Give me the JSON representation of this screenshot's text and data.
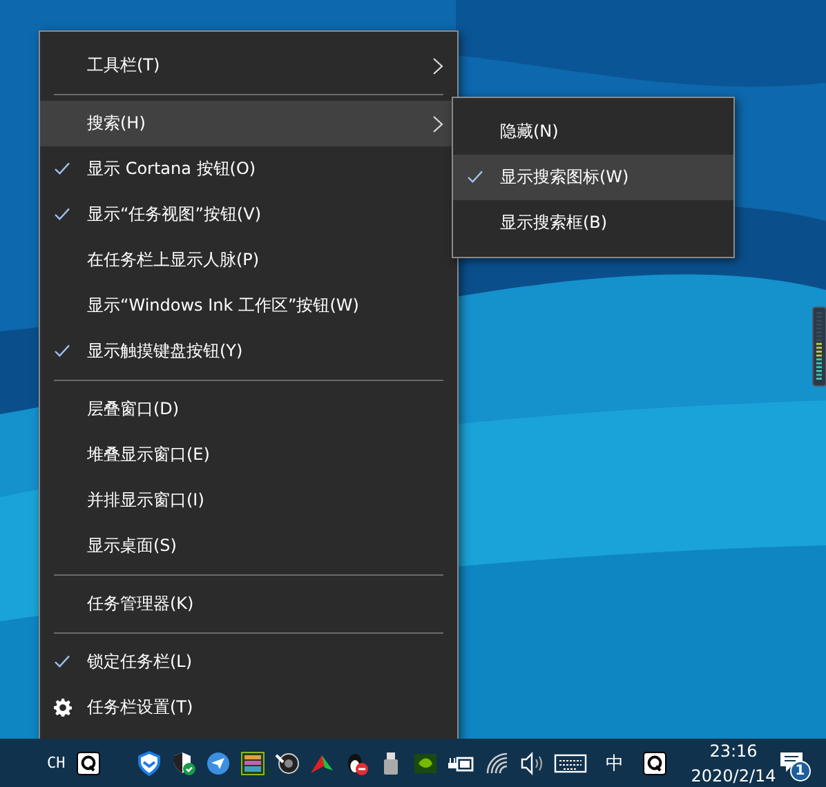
{
  "context_menu": {
    "items": [
      {
        "kind": "item",
        "label": "工具栏(T)",
        "checked": false,
        "selected": false,
        "has_submenu": true
      },
      {
        "kind": "separator"
      },
      {
        "kind": "item",
        "label": "搜索(H)",
        "checked": false,
        "selected": true,
        "has_submenu": true
      },
      {
        "kind": "item",
        "label": "显示 Cortana 按钮(O)",
        "checked": true,
        "selected": false,
        "has_submenu": false
      },
      {
        "kind": "item",
        "label": "显示“任务视图”按钮(V)",
        "checked": true,
        "selected": false,
        "has_submenu": false
      },
      {
        "kind": "item",
        "label": "在任务栏上显示人脉(P)",
        "checked": false,
        "selected": false,
        "has_submenu": false
      },
      {
        "kind": "item",
        "label": "显示“Windows Ink 工作区”按钮(W)",
        "checked": false,
        "selected": false,
        "has_submenu": false
      },
      {
        "kind": "item",
        "label": "显示触摸键盘按钮(Y)",
        "checked": true,
        "selected": false,
        "has_submenu": false
      },
      {
        "kind": "separator"
      },
      {
        "kind": "item",
        "label": "层叠窗口(D)",
        "checked": false,
        "selected": false,
        "has_submenu": false
      },
      {
        "kind": "item",
        "label": "堆叠显示窗口(E)",
        "checked": false,
        "selected": false,
        "has_submenu": false
      },
      {
        "kind": "item",
        "label": "并排显示窗口(I)",
        "checked": false,
        "selected": false,
        "has_submenu": false
      },
      {
        "kind": "item",
        "label": "显示桌面(S)",
        "checked": false,
        "selected": false,
        "has_submenu": false
      },
      {
        "kind": "separator"
      },
      {
        "kind": "item",
        "label": "任务管理器(K)",
        "checked": false,
        "selected": false,
        "has_submenu": false
      },
      {
        "kind": "separator"
      },
      {
        "kind": "item",
        "label": "锁定任务栏(L)",
        "checked": true,
        "selected": false,
        "has_submenu": false
      },
      {
        "kind": "settings",
        "label": "任务栏设置(T)",
        "checked": false,
        "selected": false,
        "has_submenu": false
      }
    ]
  },
  "submenu": {
    "items": [
      {
        "kind": "item",
        "label": "隐藏(N)",
        "checked": false,
        "selected": false,
        "has_submenu": false
      },
      {
        "kind": "item",
        "label": "显示搜索图标(W)",
        "checked": true,
        "selected": true,
        "has_submenu": false
      },
      {
        "kind": "item",
        "label": "显示搜索框(B)",
        "checked": false,
        "selected": false,
        "has_submenu": false
      }
    ]
  },
  "taskbar": {
    "language": "CH",
    "ime": "中",
    "clock_time": "23:16",
    "clock_date": "2020/2/14",
    "notification_count": "1"
  }
}
